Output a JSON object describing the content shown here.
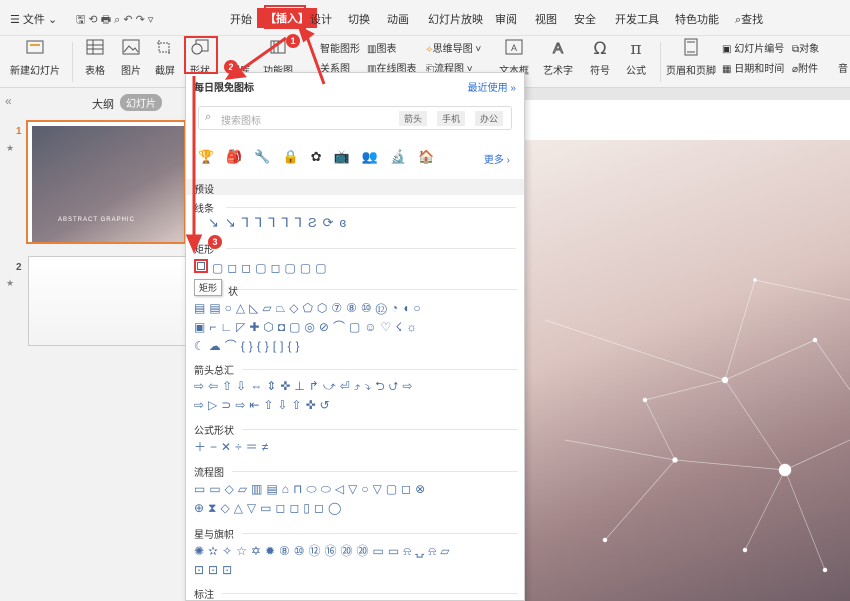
{
  "menu": {
    "file": "文件",
    "tabs": [
      "开始",
      "插入",
      "设计",
      "切换",
      "动画",
      "幻灯片放映",
      "审阅",
      "视图",
      "安全",
      "开发工具",
      "特色功能"
    ],
    "active_tab": "插入",
    "search": "查找"
  },
  "toolbar": {
    "new_slide": "新建幻灯片",
    "table": "表格",
    "picture": "图片",
    "screenshot": "截屏",
    "shape": "形状",
    "iconlib": "图库",
    "funcimg": "功能图",
    "smartart": "智能图形",
    "chart": "图表",
    "mindmap": "思维导图",
    "relation": "关系图",
    "onlinechart": "在线图表",
    "flowchart": "流程图",
    "textbox": "文本框",
    "wordart": "艺术字",
    "symbol": "符号",
    "formula": "公式",
    "headerfooter": "页眉和页脚",
    "slidenum": "幻灯片编号",
    "object": "对象",
    "datetime": "日期和时间",
    "attachment": "附件",
    "audio": "音"
  },
  "leftpanel": {
    "collapse": "«",
    "outline_tab": "大纲",
    "slides_tab": "幻灯片",
    "slide1_num": "1",
    "slide2_num": "2",
    "star": "★",
    "thumb_caption": "ABSTRACT GRAPHIC"
  },
  "dropdown": {
    "title": "每日限免图标",
    "recent": "最近使用 »",
    "search_placeholder": "搜索图标",
    "tags": [
      "箭头",
      "手机",
      "办公"
    ],
    "more": "更多 ›",
    "preset": "预设",
    "sections": {
      "lines": "线条",
      "rect": "矩形",
      "basic": "基本形状",
      "arrows": "箭头总汇",
      "formula": "公式形状",
      "flowchart": "流程图",
      "stars": "星与旗帜",
      "callouts": "标注"
    },
    "tooltip": "矩形"
  },
  "annotations": {
    "badge1": "1",
    "badge2": "2",
    "badge3": "3"
  },
  "colors": {
    "accent": "#e53935",
    "active_tab_bg": "#e53935",
    "link": "#2f6fd6"
  }
}
